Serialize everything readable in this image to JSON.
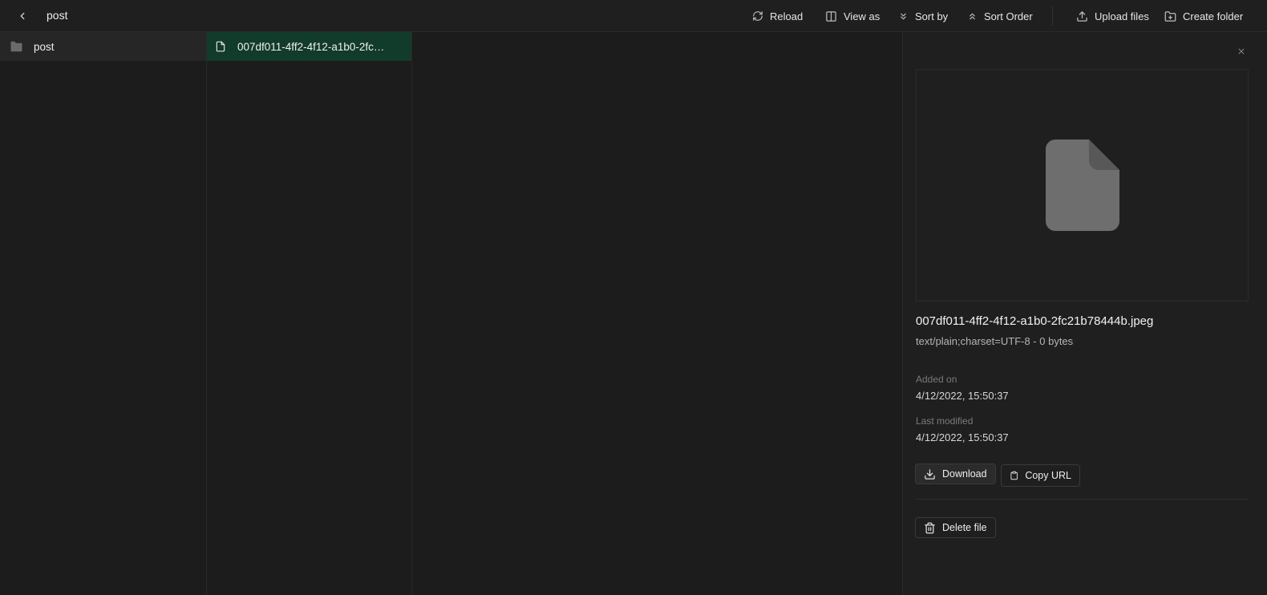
{
  "header": {
    "title": "post",
    "toolbar": {
      "reload": "Reload",
      "view_as": "View as",
      "sort_by": "Sort by",
      "sort_order": "Sort Order",
      "upload_files": "Upload files",
      "create_folder": "Create folder"
    }
  },
  "columns": {
    "folders": [
      {
        "label": "post",
        "icon": "folder-icon"
      }
    ],
    "files": [
      {
        "label": "007df011-4ff2-4f12-a1b0-2fc21b78444b.jpeg",
        "icon": "file-icon",
        "selected": true
      }
    ]
  },
  "preview": {
    "file_name": "007df011-4ff2-4f12-a1b0-2fc21b78444b.jpeg",
    "file_meta": "text/plain;charset=UTF-8 - 0 bytes",
    "added_on_label": "Added on",
    "added_on_value": "4/12/2022, 15:50:37",
    "last_modified_label": "Last modified",
    "last_modified_value": "4/12/2022, 15:50:37",
    "download_label": "Download",
    "copy_url_label": "Copy URL",
    "delete_label": "Delete file"
  },
  "colors": {
    "background": "#1c1c1c",
    "panel": "#1f1f1f",
    "selected_row": "#113b2a",
    "text": "#ededed"
  }
}
